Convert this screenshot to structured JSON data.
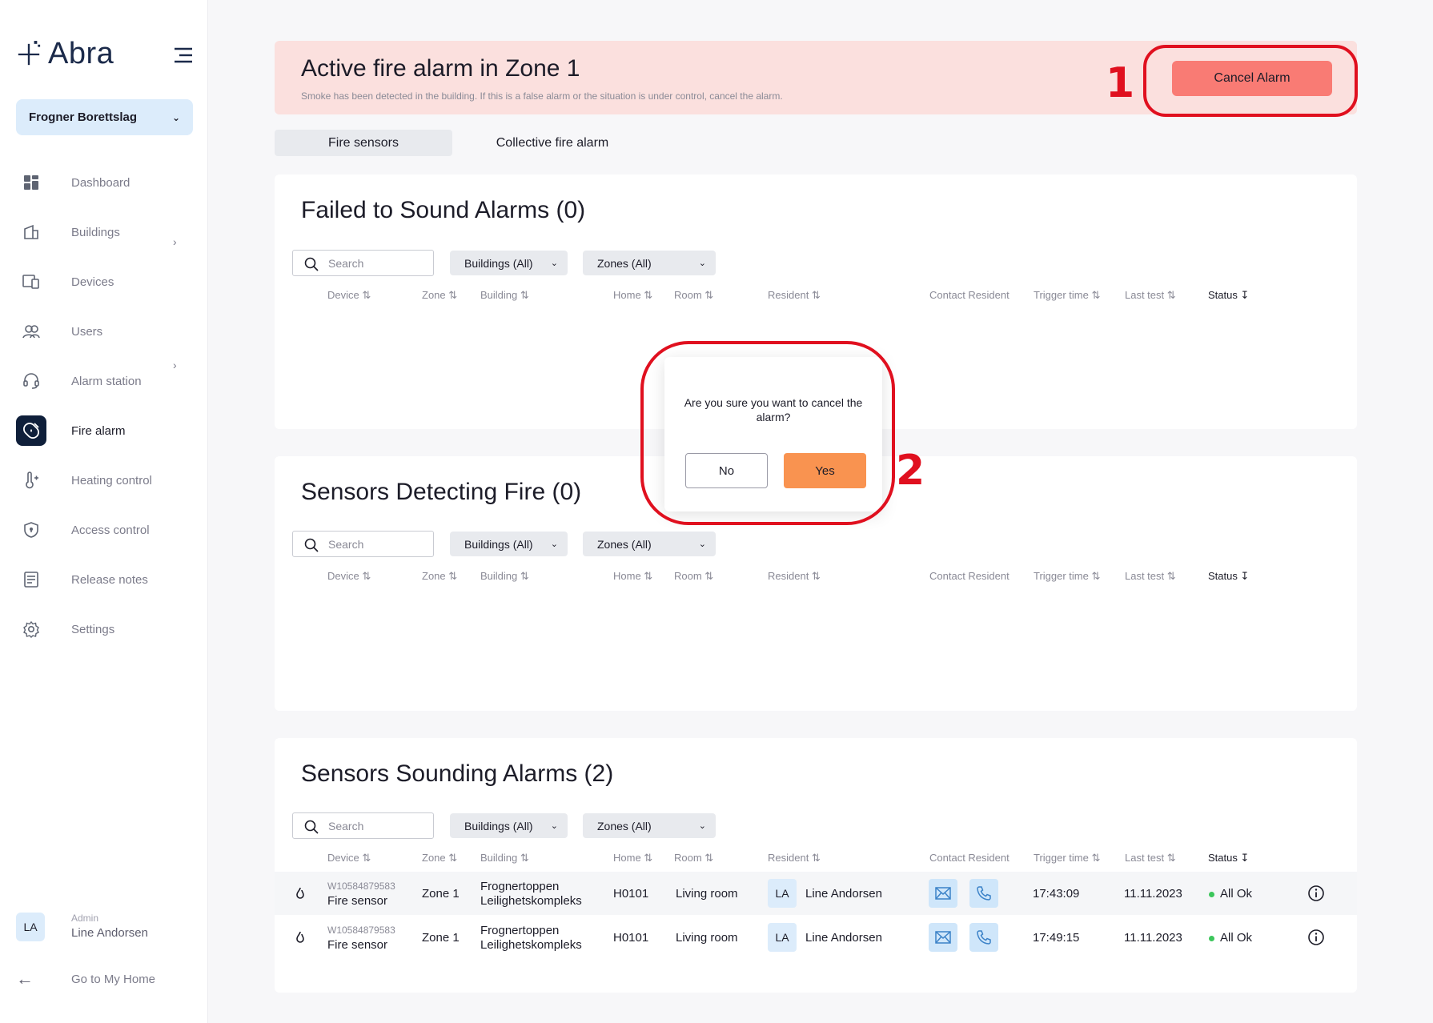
{
  "brand": {
    "name": "Abra"
  },
  "org_selector": {
    "value": "Frogner Borettslag"
  },
  "nav": {
    "items": [
      {
        "label": "Dashboard"
      },
      {
        "label": "Buildings"
      },
      {
        "label": "Devices"
      },
      {
        "label": "Users"
      },
      {
        "label": "Alarm station"
      },
      {
        "label": "Fire alarm"
      },
      {
        "label": "Heating control"
      },
      {
        "label": "Access control"
      },
      {
        "label": "Release notes"
      },
      {
        "label": "Settings"
      }
    ]
  },
  "user": {
    "initials": "LA",
    "role": "Admin",
    "name": "Line Andorsen"
  },
  "home_link": {
    "label": "Go to My Home"
  },
  "alert": {
    "title": "Active fire alarm in Zone 1",
    "subtitle": "Smoke has been detected in the building. If this is a false alarm or the situation is under control, cancel the alarm.",
    "cancel_label": "Cancel Alarm"
  },
  "annotations": {
    "one": "1",
    "two": "2"
  },
  "tabs": [
    {
      "label": "Fire sensors"
    },
    {
      "label": "Collective fire alarm"
    }
  ],
  "filters": {
    "search_placeholder": "Search",
    "buildings": "Buildings (All)",
    "zones": "Zones (All)"
  },
  "columns": {
    "device": "Device",
    "zone": "Zone",
    "building": "Building",
    "home": "Home",
    "room": "Room",
    "resident": "Resident",
    "contact": "Contact Resident",
    "trigger": "Trigger time",
    "last_test": "Last test",
    "status": "Status"
  },
  "sections": {
    "failed": {
      "title": "Failed to Sound Alarms (0)"
    },
    "detecting": {
      "title": "Sensors Detecting Fire (0)"
    },
    "sounding": {
      "title": "Sensors Sounding Alarms (2)",
      "rows": [
        {
          "device_id": "W10584879583",
          "device_type": "Fire sensor",
          "zone": "Zone 1",
          "building_line1": "Frognertoppen",
          "building_line2": "Leilighetskompleks",
          "home": "H0101",
          "room": "Living room",
          "resident_initials": "LA",
          "resident_name": "Line Andorsen",
          "trigger_time": "17:43:09",
          "last_test": "11.11.2023",
          "status": "All Ok"
        },
        {
          "device_id": "W10584879583",
          "device_type": "Fire sensor",
          "zone": "Zone 1",
          "building_line1": "Frognertoppen",
          "building_line2": "Leilighetskompleks",
          "home": "H0101",
          "room": "Living room",
          "resident_initials": "LA",
          "resident_name": "Line Andorsen",
          "trigger_time": "17:49:15",
          "last_test": "11.11.2023",
          "status": "All Ok"
        }
      ]
    }
  },
  "modal": {
    "message": "Are you sure you want to cancel the alarm?",
    "no_label": "No",
    "yes_label": "Yes"
  },
  "colors": {
    "accent_navy": "#0f1f3a",
    "alert_bg": "#fbe0de",
    "cancel_btn": "#f97b74",
    "yes_btn": "#f99350",
    "annotation_red": "#e0101f",
    "status_ok": "#3cc65b"
  }
}
